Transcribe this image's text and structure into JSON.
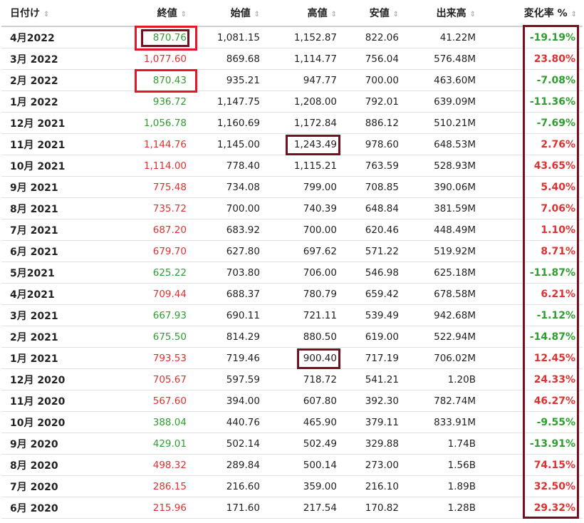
{
  "headers": [
    {
      "label": "日付け",
      "sort": "⇕"
    },
    {
      "label": "終値",
      "sort": "⇕"
    },
    {
      "label": "始値",
      "sort": "⇕"
    },
    {
      "label": "高値",
      "sort": "⇕"
    },
    {
      "label": "安値",
      "sort": "⇕"
    },
    {
      "label": "出来高",
      "sort": "⇕"
    },
    {
      "label": "変化率 %",
      "sort": "⇕"
    }
  ],
  "colors": {
    "up": "#e03131",
    "down": "#2e9e2e",
    "highlight_red": "#e5162a",
    "highlight_dark": "#7a0e1e"
  },
  "rows": [
    {
      "date": "4月2022",
      "close": "870.76",
      "open": "1,081.15",
      "high": "1,152.87",
      "low": "822.06",
      "volume": "41.22M",
      "change": "-19.19%",
      "dir": "down"
    },
    {
      "date": "3月 2022",
      "close": "1,077.60",
      "open": "869.68",
      "high": "1,114.77",
      "low": "756.04",
      "volume": "576.48M",
      "change": "23.80%",
      "dir": "up"
    },
    {
      "date": "2月 2022",
      "close": "870.43",
      "open": "935.21",
      "high": "947.77",
      "low": "700.00",
      "volume": "463.60M",
      "change": "-7.08%",
      "dir": "down"
    },
    {
      "date": "1月 2022",
      "close": "936.72",
      "open": "1,147.75",
      "high": "1,208.00",
      "low": "792.01",
      "volume": "639.09M",
      "change": "-11.36%",
      "dir": "down"
    },
    {
      "date": "12月 2021",
      "close": "1,056.78",
      "open": "1,160.69",
      "high": "1,172.84",
      "low": "886.12",
      "volume": "510.21M",
      "change": "-7.69%",
      "dir": "down"
    },
    {
      "date": "11月 2021",
      "close": "1,144.76",
      "open": "1,145.00",
      "high": "1,243.49",
      "low": "978.60",
      "volume": "648.53M",
      "change": "2.76%",
      "dir": "up"
    },
    {
      "date": "10月 2021",
      "close": "1,114.00",
      "open": "778.40",
      "high": "1,115.21",
      "low": "763.59",
      "volume": "528.93M",
      "change": "43.65%",
      "dir": "up"
    },
    {
      "date": "9月 2021",
      "close": "775.48",
      "open": "734.08",
      "high": "799.00",
      "low": "708.85",
      "volume": "390.06M",
      "change": "5.40%",
      "dir": "up"
    },
    {
      "date": "8月 2021",
      "close": "735.72",
      "open": "700.00",
      "high": "740.39",
      "low": "648.84",
      "volume": "381.59M",
      "change": "7.06%",
      "dir": "up"
    },
    {
      "date": "7月 2021",
      "close": "687.20",
      "open": "683.92",
      "high": "700.00",
      "low": "620.46",
      "volume": "448.49M",
      "change": "1.10%",
      "dir": "up"
    },
    {
      "date": "6月 2021",
      "close": "679.70",
      "open": "627.80",
      "high": "697.62",
      "low": "571.22",
      "volume": "519.92M",
      "change": "8.71%",
      "dir": "up"
    },
    {
      "date": "5月2021",
      "close": "625.22",
      "open": "703.80",
      "high": "706.00",
      "low": "546.98",
      "volume": "625.18M",
      "change": "-11.87%",
      "dir": "down"
    },
    {
      "date": "4月2021",
      "close": "709.44",
      "open": "688.37",
      "high": "780.79",
      "low": "659.42",
      "volume": "678.58M",
      "change": "6.21%",
      "dir": "up"
    },
    {
      "date": "3月 2021",
      "close": "667.93",
      "open": "690.11",
      "high": "721.11",
      "low": "539.49",
      "volume": "942.68M",
      "change": "-1.12%",
      "dir": "down"
    },
    {
      "date": "2月 2021",
      "close": "675.50",
      "open": "814.29",
      "high": "880.50",
      "low": "619.00",
      "volume": "522.94M",
      "change": "-14.87%",
      "dir": "down"
    },
    {
      "date": "1月 2021",
      "close": "793.53",
      "open": "719.46",
      "high": "900.40",
      "low": "717.19",
      "volume": "706.02M",
      "change": "12.45%",
      "dir": "up"
    },
    {
      "date": "12月 2020",
      "close": "705.67",
      "open": "597.59",
      "high": "718.72",
      "low": "541.21",
      "volume": "1.20B",
      "change": "24.33%",
      "dir": "up"
    },
    {
      "date": "11月 2020",
      "close": "567.60",
      "open": "394.00",
      "high": "607.80",
      "low": "392.30",
      "volume": "782.74M",
      "change": "46.27%",
      "dir": "up"
    },
    {
      "date": "10月 2020",
      "close": "388.04",
      "open": "440.76",
      "high": "465.90",
      "low": "379.11",
      "volume": "833.91M",
      "change": "-9.55%",
      "dir": "down"
    },
    {
      "date": "9月 2020",
      "close": "429.01",
      "open": "502.14",
      "high": "502.49",
      "low": "329.88",
      "volume": "1.74B",
      "change": "-13.91%",
      "dir": "down"
    },
    {
      "date": "8月 2020",
      "close": "498.32",
      "open": "289.84",
      "high": "500.14",
      "low": "273.00",
      "volume": "1.56B",
      "change": "74.15%",
      "dir": "up"
    },
    {
      "date": "7月 2020",
      "close": "286.15",
      "open": "216.60",
      "high": "359.00",
      "low": "216.10",
      "volume": "1.89B",
      "change": "32.50%",
      "dir": "up"
    },
    {
      "date": "6月 2020",
      "close": "215.96",
      "open": "171.60",
      "high": "217.54",
      "low": "170.82",
      "volume": "1.28B",
      "change": "29.32%",
      "dir": "up"
    }
  ]
}
